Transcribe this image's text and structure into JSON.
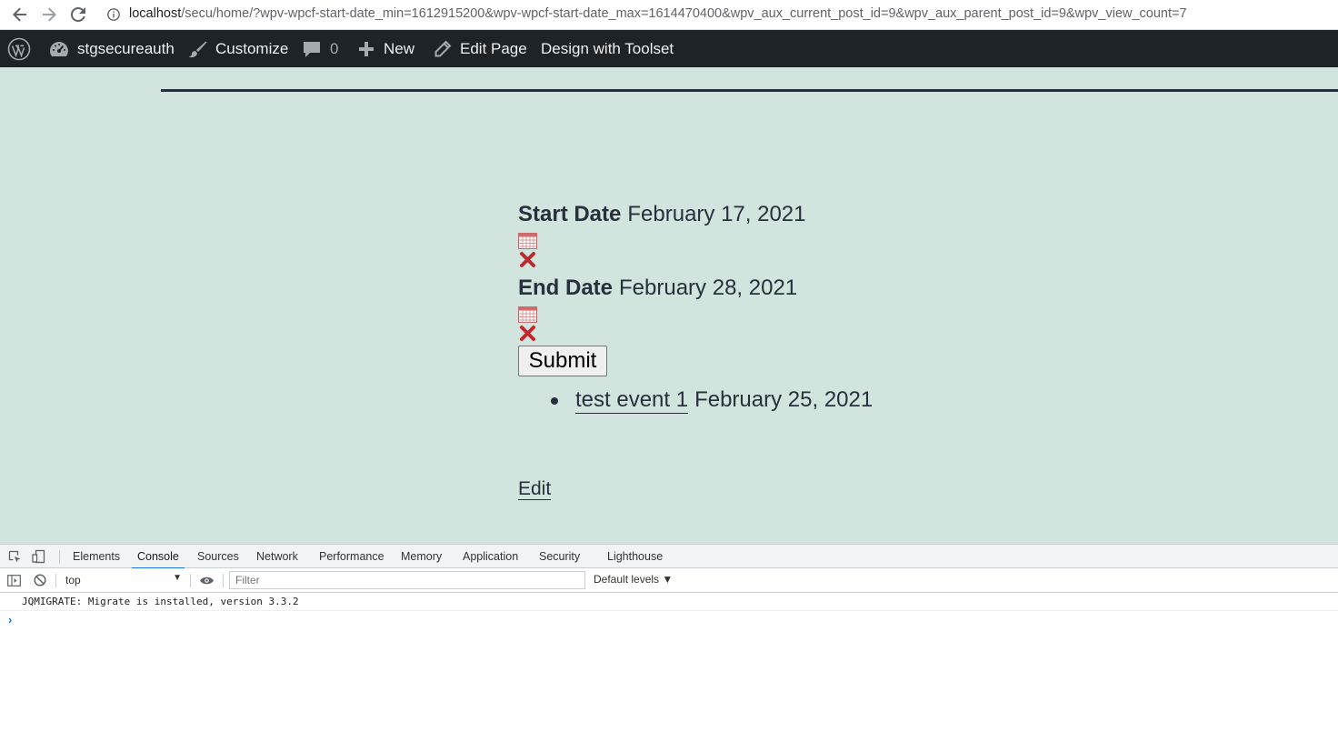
{
  "browser": {
    "url_host": "localhost",
    "url_rest": "/secu/home/?wpv-wpcf-start-date_min=1612915200&wpv-wpcf-start-date_max=1614470400&wpv_aux_current_post_id=9&wpv_aux_parent_post_id=9&wpv_view_count=7"
  },
  "admin_bar": {
    "site_name": "stgsecureauth",
    "customize": "Customize",
    "comments_count": "0",
    "new": "New",
    "edit_page": "Edit Page",
    "design": "Design with Toolset"
  },
  "form": {
    "start_label": "Start Date",
    "start_value": "February 17, 2021",
    "end_label": "End Date",
    "end_value": "February 28, 2021",
    "submit_label": "Submit"
  },
  "results": [
    {
      "title": "test event 1",
      "date": "February 25, 2021"
    }
  ],
  "edit_link": "Edit",
  "devtools": {
    "tabs": [
      "Elements",
      "Console",
      "Sources",
      "Network",
      "Performance",
      "Memory",
      "Application",
      "Security",
      "Lighthouse"
    ],
    "active_tab": "Console",
    "context": "top",
    "filter_placeholder": "Filter",
    "levels": "Default levels ▼",
    "message": "JQMIGRATE: Migrate is installed, version 3.3.2",
    "prompt": "›"
  },
  "colors": {
    "page_bg": "#d1e4dd",
    "admin_bar_bg": "#1d2327",
    "text": "#28303d",
    "accent": "#1a73e8"
  }
}
